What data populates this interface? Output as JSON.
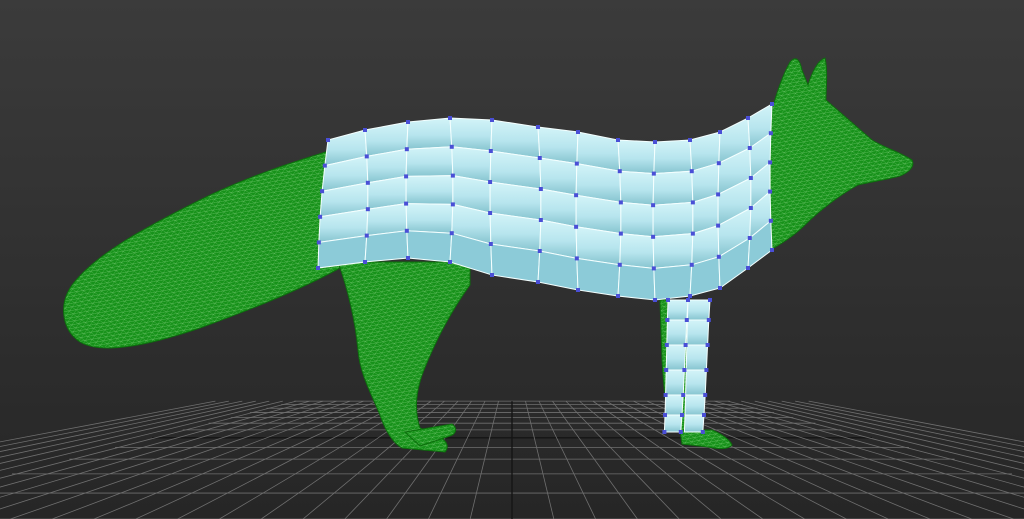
{
  "viewport": {
    "background_top": "#3a3a3a",
    "background_bottom": "#262626",
    "grid_line_color": "#6f6f6f",
    "grid_axis_color": "#151515"
  },
  "model": {
    "high_poly_color": "#1a9a14",
    "high_poly_wire": "#9fe39a",
    "retopo_color": "#bfe8f0",
    "retopo_shade": "#8ccbd8",
    "retopo_edge": "#f4ffff",
    "vertex_color": "#4a4fd6"
  }
}
